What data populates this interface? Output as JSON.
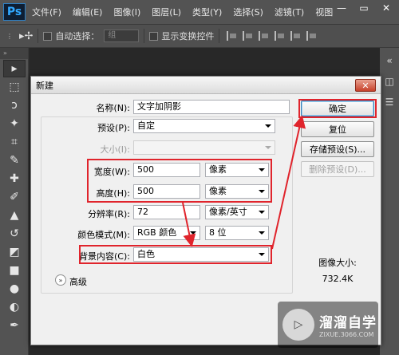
{
  "menubar": {
    "logo": "Ps",
    "items": [
      "文件(F)",
      "编辑(E)",
      "图像(I)",
      "图层(L)",
      "类型(Y)",
      "选择(S)",
      "滤镜(T)",
      "视图"
    ],
    "minimize": "—",
    "restore": "▭",
    "close": "✕"
  },
  "options": {
    "auto_select_label": "自动选择：",
    "auto_select_value": "组",
    "show_transform_label": "显示变换控件"
  },
  "dialog": {
    "title": "新建",
    "close_label": "✕",
    "name_label": "名称(N):",
    "name_value": "文字加阴影",
    "preset_label": "预设(P):",
    "preset_value": "自定",
    "size_label": "大小(I):",
    "size_value": "",
    "width_label": "宽度(W):",
    "width_value": "500",
    "width_unit": "像素",
    "height_label": "高度(H):",
    "height_value": "500",
    "height_unit": "像素",
    "resolution_label": "分辨率(R):",
    "resolution_value": "72",
    "resolution_unit": "像素/英寸",
    "color_mode_label": "颜色模式(M):",
    "color_mode_value": "RGB 颜色",
    "bit_depth_value": "8 位",
    "background_label": "背景内容(C):",
    "background_value": "白色",
    "advanced_label": "高级",
    "ok_label": "确定",
    "reset_label": "复位",
    "save_preset_label": "存储预设(S)...",
    "delete_preset_label": "删除预设(D)...",
    "image_size_label": "图像大小:",
    "image_size_value": "732.4K"
  },
  "watermark": {
    "main": "溜溜自学",
    "sub": "ZIXUE.3066.COM"
  },
  "colors": {
    "highlight": "#e0242c",
    "ps_blue": "#31a8ff"
  }
}
